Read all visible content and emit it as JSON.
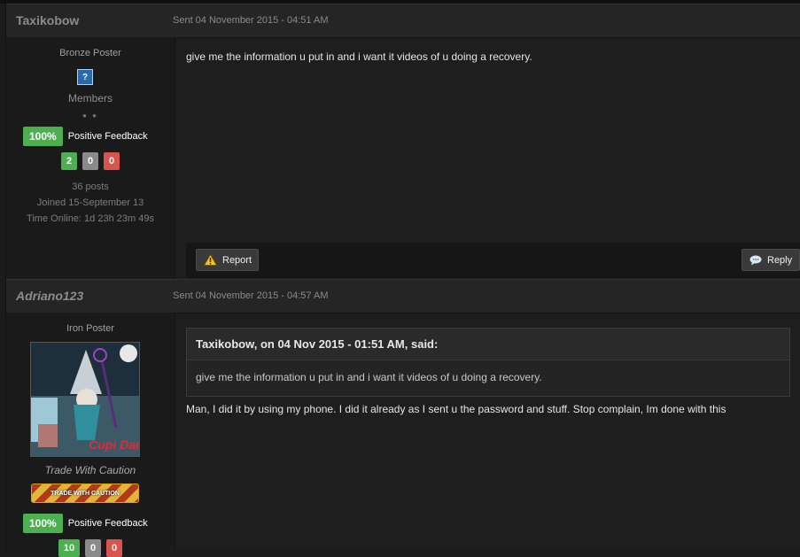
{
  "posts": [
    {
      "author": "Taxikobow",
      "sent": "Sent 04 November 2015 - 04:51 AM",
      "rank": "Bronze Poster",
      "group": "Members",
      "feedback_pct": "100%",
      "feedback_label": "Positive Feedback",
      "counts": [
        "2",
        "0",
        "0"
      ],
      "posts": "36 posts",
      "joined": "Joined 15-September 13",
      "time_online": "Time Online: 1d 23h 23m 49s",
      "body": "give me the information u put in and i want it videos of u doing a recovery.",
      "report_label": "Report",
      "reply_label": "Reply"
    },
    {
      "author": "Adriano123",
      "sent": "Sent 04 November 2015 - 04:57 AM",
      "rank": "Iron Poster",
      "group": "Trade With Caution",
      "badge": "TRADE WITH CAUTION",
      "feedback_pct": "100%",
      "feedback_label": "Positive Feedback",
      "counts": [
        "10",
        "0",
        "0"
      ],
      "quote_head": "Taxikobow, on 04 Nov 2015 - 01:51 AM, said:",
      "quote_body": "give me the information u put in and i want it videos of u doing a recovery.",
      "body": "Man, I did it by using my phone. I did it already as I sent u the password and stuff. Stop complain, Im done with this",
      "avatar_text": "Cupi Daddy"
    }
  ],
  "colors": {
    "positive": "#4caf50",
    "neutral": "#8a8a8a",
    "negative": "#d9534f"
  }
}
